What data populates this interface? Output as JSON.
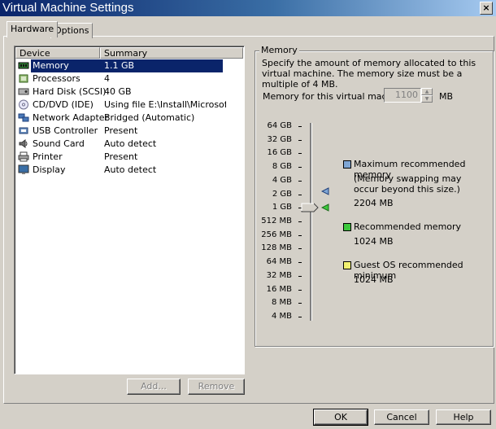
{
  "window": {
    "title": "Virtual Machine Settings",
    "close_glyph": "×"
  },
  "tabs": [
    {
      "label": "Hardware"
    },
    {
      "label": "Options"
    }
  ],
  "device_list": {
    "columns": [
      "Device",
      "Summary"
    ],
    "rows": [
      {
        "icon": "memory-icon",
        "name": "Memory",
        "summary": "1.1 GB",
        "selected": true
      },
      {
        "icon": "processor-icon",
        "name": "Processors",
        "summary": "4"
      },
      {
        "icon": "hard-disk-icon",
        "name": "Hard Disk (SCSI)",
        "summary": "40 GB"
      },
      {
        "icon": "cd-dvd-icon",
        "name": "CD/DVD (IDE)",
        "summary": "Using file E:\\Install\\Microsoft..."
      },
      {
        "icon": "network-adapter-icon",
        "name": "Network Adapter",
        "summary": "Bridged (Automatic)"
      },
      {
        "icon": "usb-controller-icon",
        "name": "USB Controller",
        "summary": "Present"
      },
      {
        "icon": "sound-card-icon",
        "name": "Sound Card",
        "summary": "Auto detect"
      },
      {
        "icon": "printer-icon",
        "name": "Printer",
        "summary": "Present"
      },
      {
        "icon": "display-icon",
        "name": "Display",
        "summary": "Auto detect"
      }
    ],
    "add_label": "Add...",
    "remove_label": "Remove"
  },
  "memory": {
    "group_label": "Memory",
    "description": "Specify the amount of memory allocated to this virtual machine. The memory size must be a multiple of 4 MB.",
    "field_label": "Memory for this virtual machine:",
    "value": "1100",
    "unit": "MB",
    "scale": [
      "64 GB",
      "32 GB",
      "16 GB",
      "8 GB",
      "4 GB",
      "2 GB",
      "1 GB",
      "512 MB",
      "256 MB",
      "128 MB",
      "64 MB",
      "32 MB",
      "16 MB",
      "8 MB",
      "4 MB"
    ],
    "legend": {
      "max": {
        "title": "Maximum recommended memory",
        "note": "(Memory swapping may occur beyond this size.)",
        "value": "2204 MB",
        "color": "#7fa6d4"
      },
      "recommended": {
        "title": "Recommended memory",
        "value": "1024 MB",
        "color": "#3cc83c"
      },
      "guest_min": {
        "title": "Guest OS recommended minimum",
        "value": "1024 MB",
        "color": "#f0f070"
      }
    }
  },
  "footer": {
    "ok_label": "OK",
    "cancel_label": "Cancel",
    "help_label": "Help"
  },
  "colors": {
    "selection": "#0a246a",
    "dialog_bg": "#d4d0c8"
  }
}
